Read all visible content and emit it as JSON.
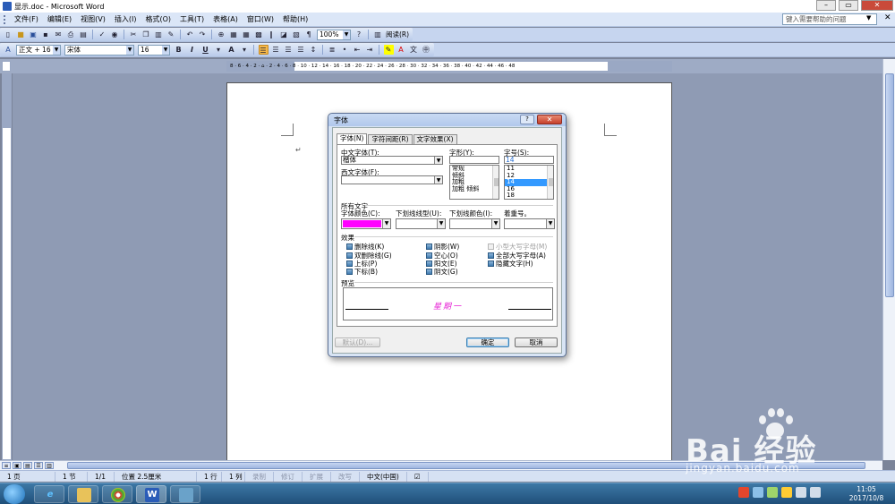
{
  "window": {
    "title": "显示.doc - Microsoft Word",
    "controls": [
      "min-icon",
      "max-icon",
      "close-icon"
    ]
  },
  "menubar": {
    "items": [
      "文件(F)",
      "编辑(E)",
      "视图(V)",
      "插入(I)",
      "格式(O)",
      "工具(T)",
      "表格(A)",
      "窗口(W)",
      "帮助(H)"
    ],
    "help_placeholder": "键入需要帮助的问题"
  },
  "toolbar": {
    "zoom": "100%",
    "read_label": "阅读(R)",
    "style": "正文 + 16 磅",
    "font": "宋体",
    "size": "16",
    "bold": "B",
    "italic": "I",
    "underline": "U",
    "char_a": "A"
  },
  "ruler": {
    "numbers": "8 · 6 · 4 · 2 · ⌂ · 2 · 4 · 6 · 8 · 10 · 12 · 14 · 16 · 18 · 20 · 22 · 24 · 26 · 28 · 30 · 32 · 34 · 36 · 38 · 40 · 42 · 44 · 46 · 48"
  },
  "document": {
    "para_mark": "↵"
  },
  "dialog": {
    "title": "字体",
    "help": "?",
    "close": "✕",
    "tabs": [
      "字体(N)",
      "字符间距(R)",
      "文字效果(X)"
    ],
    "cn_font_label": "中文字体(T):",
    "cn_font_value": "楷体",
    "west_font_label": "西文字体(F):",
    "west_font_value": "",
    "style_label": "字形(Y):",
    "style_value": "",
    "style_options": [
      "常规",
      "倾斜",
      "加粗",
      "加粗 倾斜"
    ],
    "size_label": "字号(S):",
    "size_value": "14",
    "size_options": [
      "11",
      "12",
      "14",
      "16",
      "18"
    ],
    "size_selected_index": 2,
    "all_text_label": "所有文字",
    "font_color_label": "字体颜色(C):",
    "underline_type_label": "下划线线型(U):",
    "underline_color_label": "下划线颜色(I):",
    "emphasis_label": "着重号。",
    "font_color": "#ff00ff",
    "effects_label": "效果",
    "effects": [
      {
        "label": "删除线(K)",
        "enabled": true
      },
      {
        "label": "阴影(W)",
        "enabled": true
      },
      {
        "label": "小型大写字母(M)",
        "enabled": false
      },
      {
        "label": "双删除线(G)",
        "enabled": true
      },
      {
        "label": "空心(O)",
        "enabled": true
      },
      {
        "label": "全部大写字母(A)",
        "enabled": true
      },
      {
        "label": "上标(P)",
        "enabled": true
      },
      {
        "label": "阳文(E)",
        "enabled": true
      },
      {
        "label": "隐藏文字(H)",
        "enabled": true
      },
      {
        "label": "下标(B)",
        "enabled": true
      },
      {
        "label": "阴文(G)",
        "enabled": true
      }
    ],
    "preview_label": "预览",
    "preview_text": "星期一",
    "preview_color": "#e61fd4",
    "default_button": "默认(D)...",
    "ok_button": "确定",
    "cancel_button": "取消"
  },
  "statusbar": {
    "page": "1 页",
    "section": "1 节",
    "page_of": "1/1",
    "position": "位置 2.5厘米",
    "line": "1 行",
    "column": "1 列",
    "rec": "录制",
    "trk": "修订",
    "ext": "扩展",
    "ovr": "改写",
    "language": "中文(中国)"
  },
  "taskbar": {
    "time": "11:05",
    "date": "2017/10/8",
    "word_icon_letter": "W"
  },
  "watermark": {
    "brand": "Bai  经验",
    "url": "jingyan.baidu.com"
  }
}
